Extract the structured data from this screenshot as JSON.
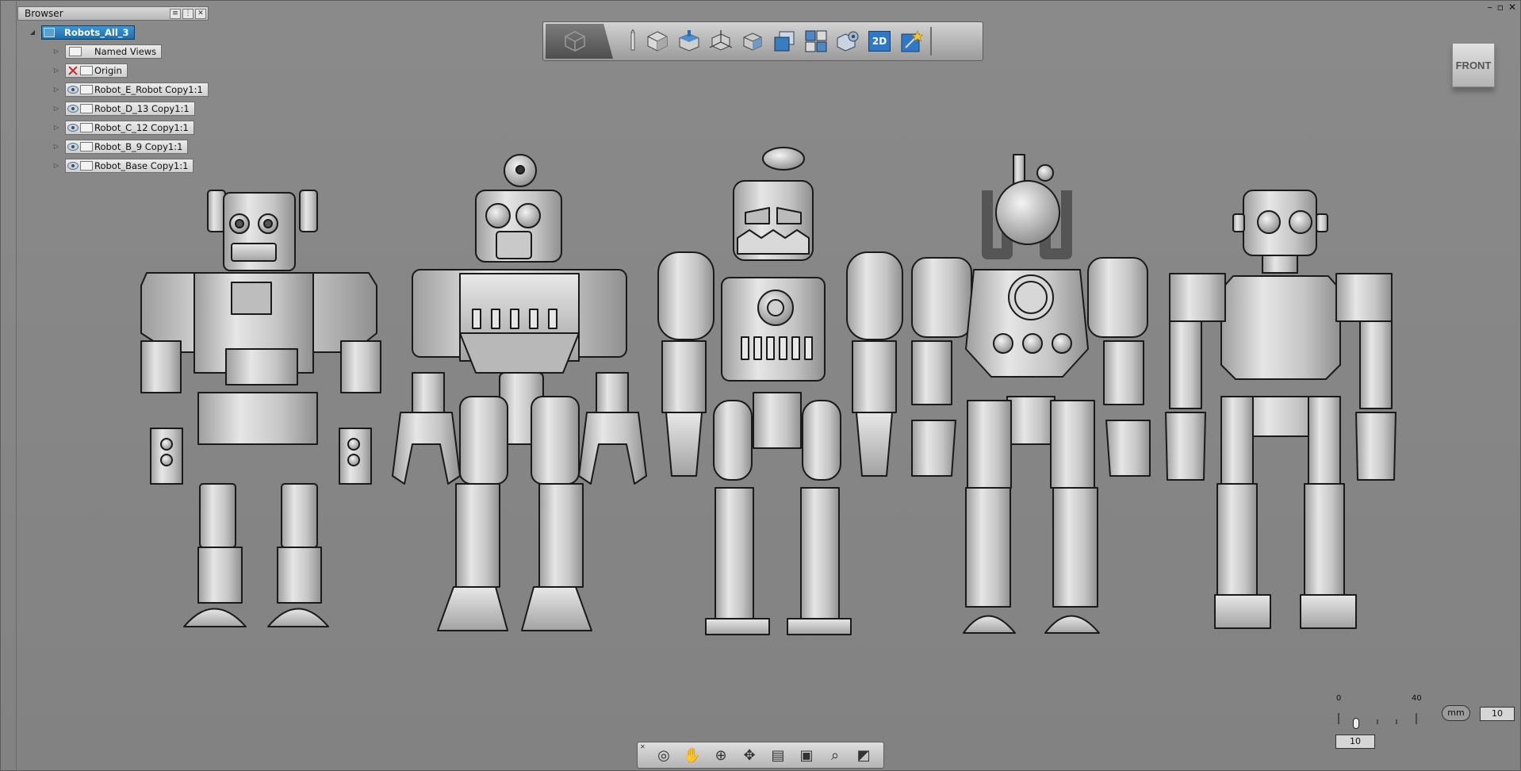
{
  "browser": {
    "title": "Browser",
    "root": "Robots_All_3",
    "items": [
      {
        "label": "Named Views"
      },
      {
        "label": "Origin"
      },
      {
        "label": "Robot_E_Robot Copy1:1"
      },
      {
        "label": "Robot_D_13 Copy1:1"
      },
      {
        "label": "Robot_C_12 Copy1:1"
      },
      {
        "label": "Robot_B_9 Copy1:1"
      },
      {
        "label": "Robot_Base Copy1:1"
      }
    ]
  },
  "viewcube": {
    "label": "FRONT"
  },
  "toolbar": {
    "icons": [
      "home-cube-icon",
      "sketch-pencil-icon",
      "box-icon",
      "box-top-icon",
      "box-axis-icon",
      "rotate-box-icon",
      "stacked-squares-icon",
      "quad-view-icon",
      "gear-box-icon",
      "view-2d-icon",
      "star-wand-icon"
    ],
    "view2d_label": "2D"
  },
  "scale": {
    "min_label": "0",
    "max_label": "40",
    "unit": "mm",
    "value": "10",
    "field_value": "10"
  },
  "nav": {
    "icons": [
      "orbit-icon",
      "pan-hand-icon",
      "zoom-icon",
      "move-icon",
      "look-at-icon",
      "view-box-icon",
      "magnify-icon",
      "section-icon"
    ]
  },
  "window": {
    "minimize": "–",
    "restore": "▫",
    "close": "✕"
  }
}
